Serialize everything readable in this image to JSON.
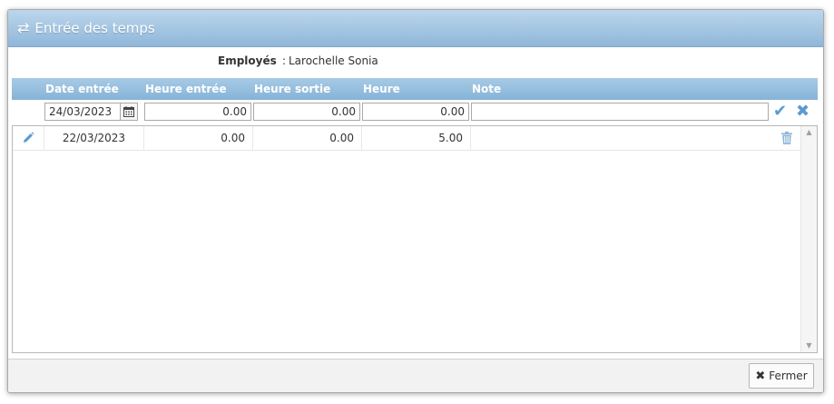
{
  "dialog": {
    "title": "Entrée des temps",
    "title_icon": "exchange-arrows-icon"
  },
  "employee": {
    "label": "Employés",
    "colon": ":",
    "value": "Larochelle Sonia"
  },
  "grid": {
    "columns": [
      "Date entrée",
      "Heure entrée",
      "Heure sortie",
      "Heure",
      "Note"
    ]
  },
  "entry": {
    "date": "24/03/2023",
    "heure_entree": "0.00",
    "heure_sortie": "0.00",
    "heure": "0.00",
    "note": ""
  },
  "rows": [
    {
      "date": "22/03/2023",
      "heure_entree": "0.00",
      "heure_sortie": "0.00",
      "heure": "5.00",
      "note": ""
    }
  ],
  "footer": {
    "close_label": "Fermer"
  },
  "colors": {
    "accent": "#5b9bd1",
    "header_bg": "#8fb7d9"
  }
}
